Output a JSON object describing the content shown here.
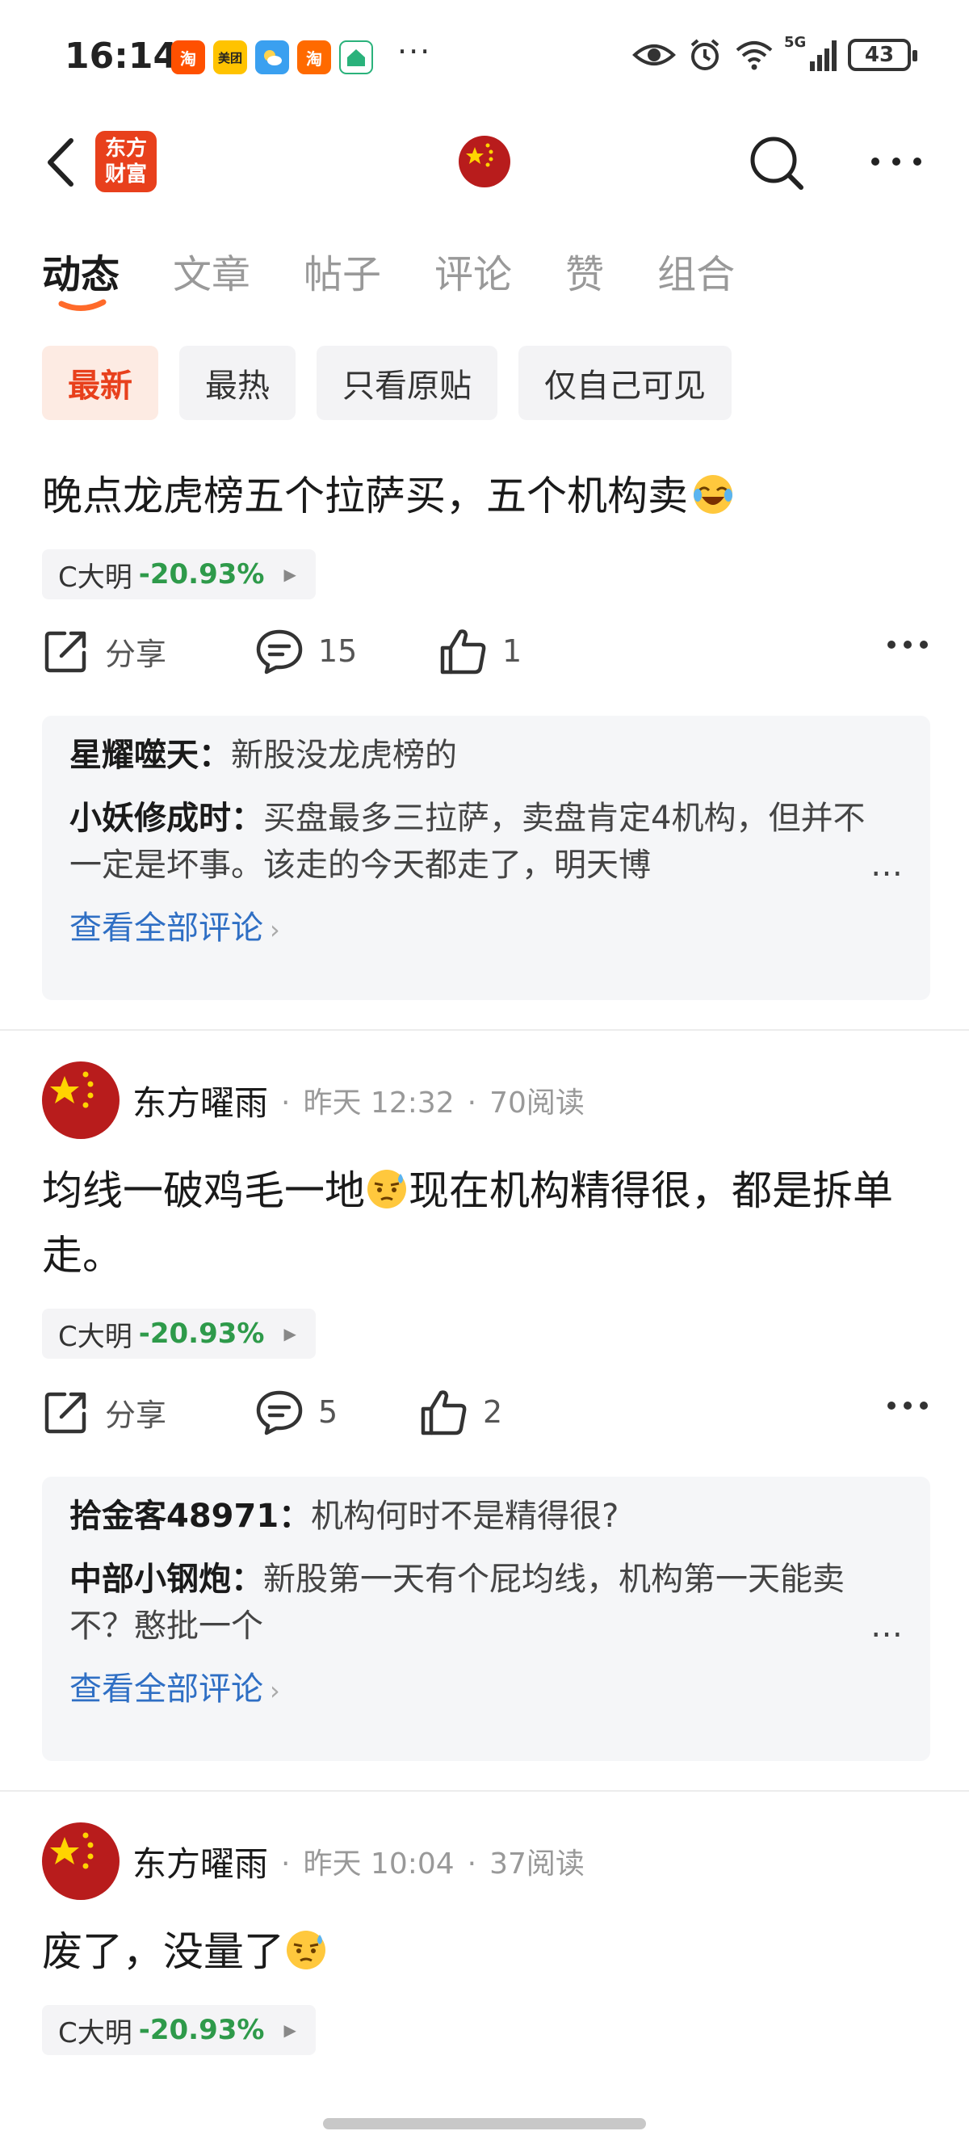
{
  "status_bar": {
    "time": "16:14",
    "app_icons": [
      {
        "icon": "taobao-icon",
        "label": "淘",
        "color": "#ff5000"
      },
      {
        "icon": "meituan-icon",
        "label": "美团",
        "color": "#ffc300"
      },
      {
        "icon": "weather-icon",
        "label": "",
        "color": "#3aa0f0"
      },
      {
        "icon": "taobao-flash-icon",
        "label": "淘",
        "color": "#ff6a00"
      },
      {
        "icon": "home-app-icon",
        "label": "",
        "color": "#2ab27b"
      }
    ],
    "overflow": "···",
    "network": "5G",
    "battery": "43"
  },
  "header": {
    "logo_text": "东方\n财富"
  },
  "tabs": [
    {
      "label": "动态",
      "active": true
    },
    {
      "label": "文章"
    },
    {
      "label": "帖子"
    },
    {
      "label": "评论"
    },
    {
      "label": "赞"
    },
    {
      "label": "组合"
    }
  ],
  "filters": [
    {
      "label": "最新",
      "active": true
    },
    {
      "label": "最热"
    },
    {
      "label": "只看原贴"
    },
    {
      "label": "仅自己可见"
    }
  ],
  "posts": [
    {
      "text": "晚点龙虎榜五个拉萨买，五个机构卖",
      "stock": {
        "name": "C大明",
        "change": "-20.93%"
      },
      "share_label": "分享",
      "comment_count": "15",
      "like_count": "1",
      "comments": [
        {
          "author": "星耀噬天：",
          "text": "新股没龙虎榜的"
        },
        {
          "author": "小妖修成时：",
          "text": "买盘最多三拉萨，卖盘肯定4机构，但并不一定是坏事。该走的今天都走了，明天博"
        }
      ],
      "view_all": "查看全部评论"
    },
    {
      "author": "东方曜雨",
      "time": "昨天 12:32",
      "reads": "70阅读",
      "text_a": "均线一破鸡毛一地",
      "text_b": "现在机构精得很，都是拆单走。",
      "stock": {
        "name": "C大明",
        "change": "-20.93%"
      },
      "share_label": "分享",
      "comment_count": "5",
      "like_count": "2",
      "comments": [
        {
          "author": "拾金客48971：",
          "text": "机构何时不是精得很?"
        },
        {
          "author": "中部小钢炮：",
          "text": "新股第一天有个屁均线，机构第一天能卖不？憨批一个"
        }
      ],
      "view_all": "查看全部评论"
    },
    {
      "author": "东方曜雨",
      "time": "昨天 10:04",
      "reads": "37阅读",
      "text": "废了，没量了",
      "stock": {
        "name": "C大明",
        "change": "-20.93%"
      }
    }
  ]
}
